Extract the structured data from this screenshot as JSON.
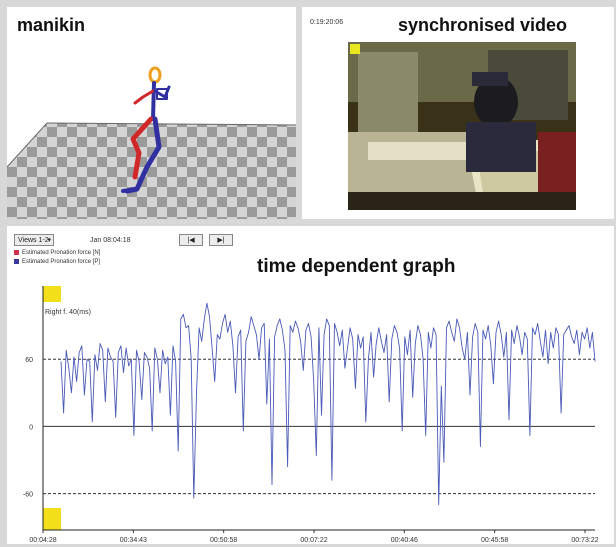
{
  "panels": {
    "manikin": {
      "title": "manikin"
    },
    "video": {
      "title": "synchronised video",
      "timestamp": "0:19:20:06"
    },
    "graph": {
      "title": "time dependent graph"
    }
  },
  "toolbar": {
    "view_select": "Views 1-2",
    "date_label": "Jan 08:04:18",
    "prev_label": "|◀",
    "next_label": "▶|"
  },
  "legend": [
    {
      "label": "Estimated Pronation force [N]",
      "color": "#d0304a"
    },
    {
      "label": "Estimated Pronation force [P]",
      "color": "#3a3a9c"
    }
  ],
  "colors": {
    "line": "#4a5ab8",
    "highlight": "#f4e01a"
  },
  "chart_data": {
    "type": "line",
    "annotation": "Right f. 40(ms)",
    "y_ticks": [
      "60",
      "0",
      "-60"
    ],
    "x_ticks": [
      "00:04:28",
      "00:34:43",
      "00:50:58",
      "00:07:22",
      "00:40:46",
      "00:45:58",
      "00:73:22"
    ],
    "ref_lines": [
      60,
      0,
      -60
    ],
    "ylim": [
      -80,
      120
    ],
    "series": [
      {
        "values": [
          58,
          12,
          68,
          52,
          30,
          62,
          40,
          66,
          72,
          28,
          60,
          58,
          4,
          64,
          50,
          74,
          68,
          22,
          70,
          62,
          58,
          8,
          66,
          72,
          48,
          70,
          54,
          60,
          -8,
          68,
          58,
          24,
          66,
          62,
          52,
          -4,
          70,
          60,
          30,
          68,
          56,
          62,
          10,
          72,
          58,
          -22,
          96,
          100,
          88,
          90,
          60,
          -64,
          30,
          88,
          76,
          96,
          110,
          98,
          70,
          40,
          82,
          78,
          92,
          100,
          84,
          94,
          72,
          30,
          80,
          86,
          -4,
          76,
          84,
          98,
          90,
          82,
          60,
          88,
          92,
          20,
          78,
          -52,
          80,
          90,
          96,
          86,
          68,
          -36,
          90,
          84,
          94,
          88,
          76,
          50,
          86,
          92,
          80,
          40,
          -26,
          88,
          10,
          82,
          96,
          90,
          -48,
          92,
          84,
          72,
          86,
          52,
          70,
          88,
          78,
          34,
          82,
          70,
          80,
          4,
          60,
          84,
          44,
          74,
          88,
          76,
          66,
          82,
          22,
          78,
          90,
          84,
          70,
          -4,
          80,
          64,
          86,
          26,
          74,
          90,
          82,
          60,
          -8,
          84,
          70,
          88,
          82,
          -70,
          36,
          -32,
          88,
          94,
          84,
          76,
          96,
          88,
          70,
          60,
          84,
          28,
          80,
          92,
          84,
          -18,
          86,
          78,
          90,
          72,
          38,
          84,
          94,
          82,
          62,
          84,
          6,
          86,
          74,
          90,
          80,
          64,
          84,
          78,
          -8,
          88,
          82,
          92,
          76,
          62,
          86,
          56,
          84,
          70,
          88,
          82,
          12,
          82,
          86,
          90,
          80,
          74,
          86,
          64,
          84,
          78,
          88,
          70,
          84,
          58
        ]
      }
    ]
  }
}
